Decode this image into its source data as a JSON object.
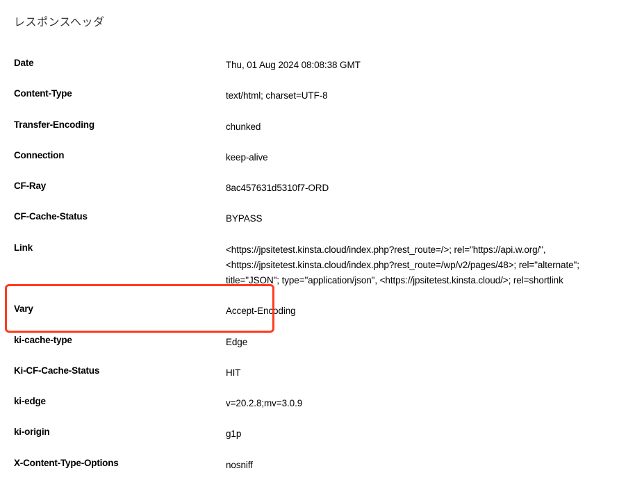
{
  "title": "レスポンスヘッダ",
  "headers": [
    {
      "name": "Date",
      "value": "Thu, 01 Aug 2024 08:08:38 GMT"
    },
    {
      "name": "Content-Type",
      "value": "text/html; charset=UTF-8"
    },
    {
      "name": "Transfer-Encoding",
      "value": "chunked"
    },
    {
      "name": "Connection",
      "value": "keep-alive"
    },
    {
      "name": "CF-Ray",
      "value": "8ac457631d5310f7-ORD"
    },
    {
      "name": "CF-Cache-Status",
      "value": "BYPASS"
    },
    {
      "name": "Link",
      "value": "<https://jpsitetest.kinsta.cloud/index.php?rest_route=/>; rel=\"https://api.w.org/\", <https://jpsitetest.kinsta.cloud/index.php?rest_route=/wp/v2/pages/48>; rel=\"alternate\"; title=\"JSON\"; type=\"application/json\", <https://jpsitetest.kinsta.cloud/>; rel=shortlink"
    },
    {
      "name": "Vary",
      "value": "Accept-Encoding"
    },
    {
      "name": "ki-cache-type",
      "value": "Edge"
    },
    {
      "name": "Ki-CF-Cache-Status",
      "value": "HIT"
    },
    {
      "name": "ki-edge",
      "value": "v=20.2.8;mv=3.0.9"
    },
    {
      "name": "ki-origin",
      "value": "g1p"
    },
    {
      "name": "X-Content-Type-Options",
      "value": "nosniff"
    }
  ]
}
